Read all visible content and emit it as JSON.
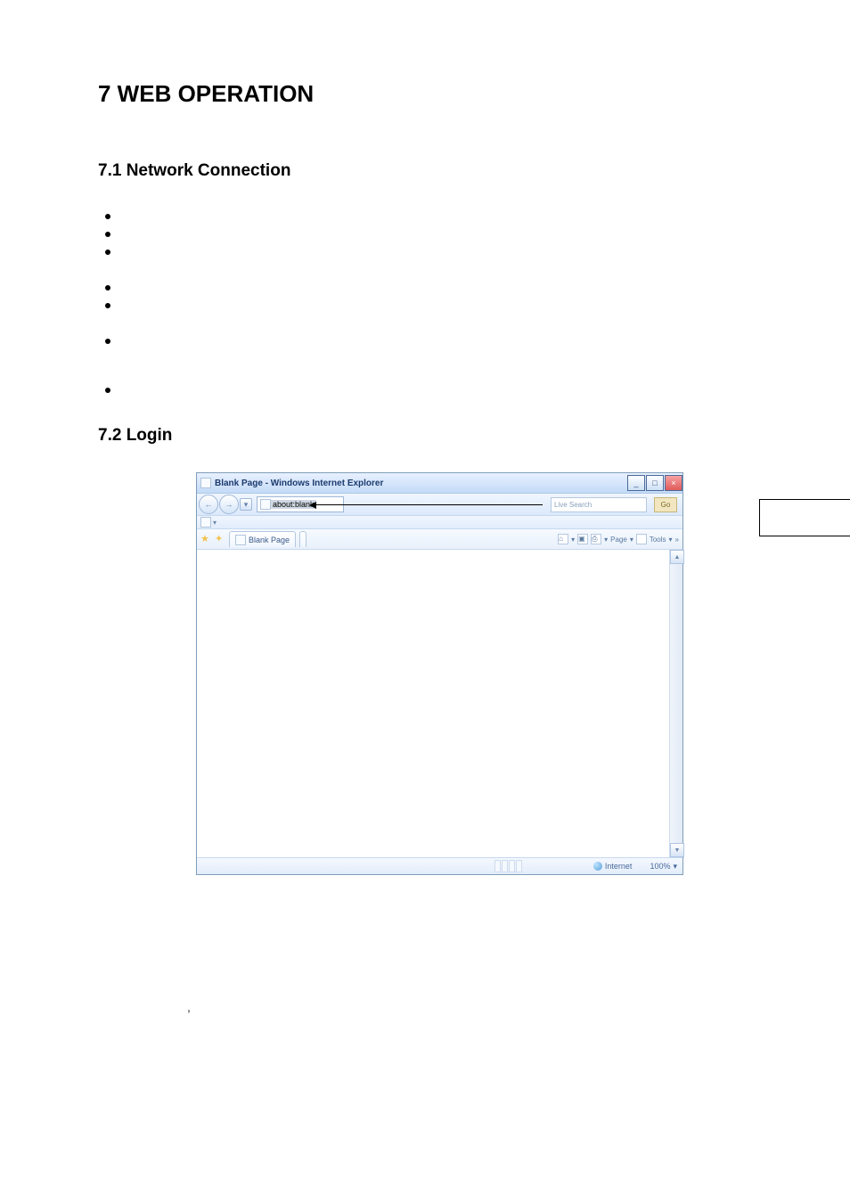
{
  "doc": {
    "h1": "7  WEB OPERATION",
    "s1": {
      "heading": "7.1  Network Connection",
      "bullets": [
        "",
        "",
        "",
        "",
        "",
        "",
        ""
      ]
    },
    "s2": {
      "heading": "7.2  Login"
    }
  },
  "ie": {
    "title": "Blank Page - Windows Internet Explorer",
    "address": "about:blank",
    "search_placeholder": "Live Search",
    "go": "Go",
    "tab_label": "Blank Page",
    "toolbar": {
      "page": "Page",
      "tools": "Tools"
    },
    "status": {
      "zone": "Internet",
      "zoom": "100%"
    },
    "win_controls": {
      "min": "_",
      "max": "□",
      "close": "×"
    },
    "nav": {
      "back": "←",
      "fwd": "→",
      "addr_drop": "▾"
    },
    "scroll": {
      "up": "▲",
      "down": "▼"
    },
    "icon_glyphs": {
      "home": "⌂",
      "feed": "▣",
      "print": "⎙",
      "zoom_drop": "▾",
      "chevrons": "»"
    }
  },
  "annot": {
    "text": ""
  },
  "trailing_comma": ","
}
